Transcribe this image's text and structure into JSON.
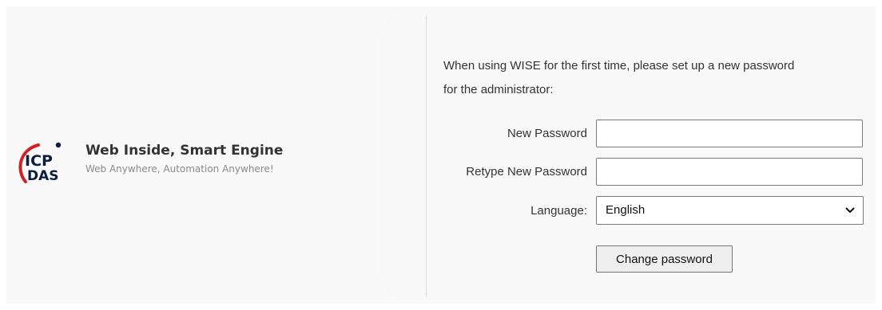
{
  "branding": {
    "logo_lines": [
      "ICP",
      "DAS"
    ],
    "slogan_title": "Web Inside, Smart Engine",
    "slogan_subtitle": "Web Anywhere, Automation Anywhere!",
    "logo_text_color": "#0d1d3f",
    "logo_arc_color": "#d32027"
  },
  "form": {
    "intro_line1": "When using WISE for the first time, please set up a new password",
    "intro_line2": "for the administrator:",
    "new_password_label": "New Password",
    "new_password_value": "",
    "retype_password_label": "Retype New Password",
    "retype_password_value": "",
    "language_label": "Language:",
    "language_selected": "English",
    "submit_label": "Change password"
  }
}
